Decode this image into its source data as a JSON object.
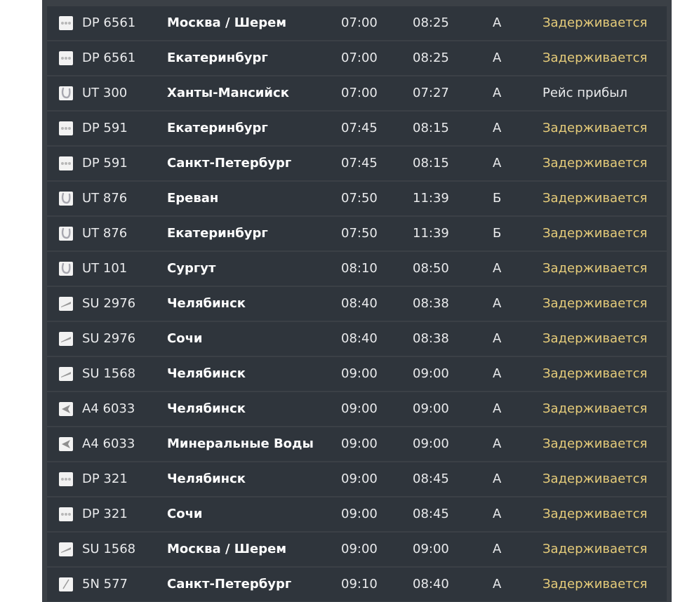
{
  "colors": {
    "board_bg": "#3b4046",
    "row_bg": "#2f353c",
    "status_delayed": "#e6cc7a",
    "status_arrived": "#e9eaec"
  },
  "flights": [
    {
      "logo": "airline-dots-icon",
      "flight": "DP 6561",
      "city": "Москва / Шерем",
      "scheduled": "07:00",
      "actual": "08:25",
      "terminal": "A",
      "status": "Задерживается",
      "status_type": "delayed"
    },
    {
      "logo": "airline-dots-icon",
      "flight": "DP 6561",
      "city": "Екатеринбург",
      "scheduled": "07:00",
      "actual": "08:25",
      "terminal": "A",
      "status": "Задерживается",
      "status_type": "delayed"
    },
    {
      "logo": "airline-u-icon",
      "flight": "UT 300",
      "city": "Ханты-Мансийск",
      "scheduled": "07:00",
      "actual": "07:27",
      "terminal": "A",
      "status": "Рейс прибыл",
      "status_type": "arrived"
    },
    {
      "logo": "airline-dots-icon",
      "flight": "DP 591",
      "city": "Екатеринбург",
      "scheduled": "07:45",
      "actual": "08:15",
      "terminal": "A",
      "status": "Задерживается",
      "status_type": "delayed"
    },
    {
      "logo": "airline-dots-icon",
      "flight": "DP 591",
      "city": "Санкт-Петербург",
      "scheduled": "07:45",
      "actual": "08:15",
      "terminal": "A",
      "status": "Задерживается",
      "status_type": "delayed"
    },
    {
      "logo": "airline-u-icon",
      "flight": "UT 876",
      "city": "Ереван",
      "scheduled": "07:50",
      "actual": "11:39",
      "terminal": "Б",
      "status": "Задерживается",
      "status_type": "delayed"
    },
    {
      "logo": "airline-u-icon",
      "flight": "UT 876",
      "city": "Екатеринбург",
      "scheduled": "07:50",
      "actual": "11:39",
      "terminal": "Б",
      "status": "Задерживается",
      "status_type": "delayed"
    },
    {
      "logo": "airline-u-icon",
      "flight": "UT 101",
      "city": "Сургут",
      "scheduled": "08:10",
      "actual": "08:50",
      "terminal": "A",
      "status": "Задерживается",
      "status_type": "delayed"
    },
    {
      "logo": "airline-stripe-icon",
      "flight": "SU 2976",
      "city": "Челябинск",
      "scheduled": "08:40",
      "actual": "08:38",
      "terminal": "A",
      "status": "Задерживается",
      "status_type": "delayed"
    },
    {
      "logo": "airline-stripe-icon",
      "flight": "SU 2976",
      "city": "Сочи",
      "scheduled": "08:40",
      "actual": "08:38",
      "terminal": "A",
      "status": "Задерживается",
      "status_type": "delayed"
    },
    {
      "logo": "airline-stripe-icon",
      "flight": "SU 1568",
      "city": "Челябинск",
      "scheduled": "09:00",
      "actual": "09:00",
      "terminal": "A",
      "status": "Задерживается",
      "status_type": "delayed"
    },
    {
      "logo": "airline-chevron-icon",
      "flight": "A4 6033",
      "city": "Челябинск",
      "scheduled": "09:00",
      "actual": "09:00",
      "terminal": "A",
      "status": "Задерживается",
      "status_type": "delayed"
    },
    {
      "logo": "airline-chevron-icon",
      "flight": "A4 6033",
      "city": "Минеральные Воды",
      "scheduled": "09:00",
      "actual": "09:00",
      "terminal": "A",
      "status": "Задерживается",
      "status_type": "delayed"
    },
    {
      "logo": "airline-dots-icon",
      "flight": "DP 321",
      "city": "Челябинск",
      "scheduled": "09:00",
      "actual": "08:45",
      "terminal": "A",
      "status": "Задерживается",
      "status_type": "delayed"
    },
    {
      "logo": "airline-dots-icon",
      "flight": "DP 321",
      "city": "Сочи",
      "scheduled": "09:00",
      "actual": "08:45",
      "terminal": "A",
      "status": "Задерживается",
      "status_type": "delayed"
    },
    {
      "logo": "airline-stripe-icon",
      "flight": "SU 1568",
      "city": "Москва / Шерем",
      "scheduled": "09:00",
      "actual": "09:00",
      "terminal": "A",
      "status": "Задерживается",
      "status_type": "delayed"
    },
    {
      "logo": "airline-feather-icon",
      "flight": "5N 577",
      "city": "Санкт-Петербург",
      "scheduled": "09:10",
      "actual": "08:40",
      "terminal": "A",
      "status": "Задерживается",
      "status_type": "delayed"
    }
  ]
}
